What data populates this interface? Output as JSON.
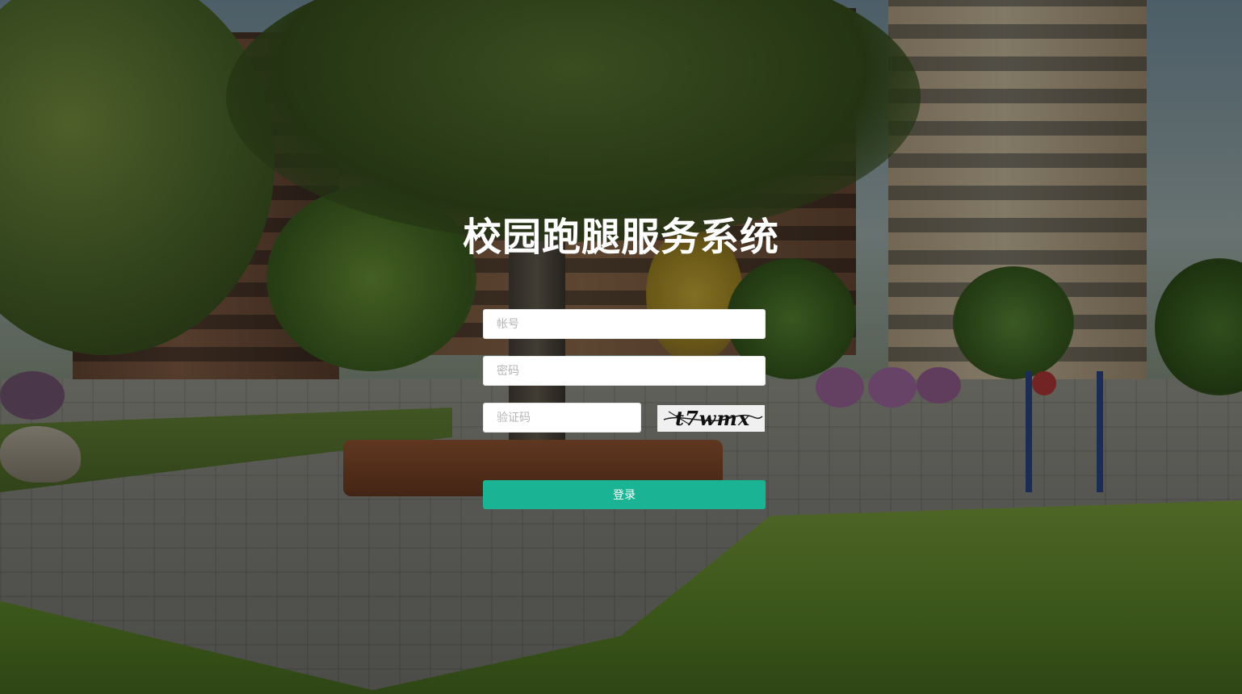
{
  "title": "校园跑腿服务系统",
  "form": {
    "account_placeholder": "帐号",
    "password_placeholder": "密码",
    "captcha_placeholder": "验证码",
    "captcha_image_text": "t7wmx",
    "login_label": "登录"
  },
  "colors": {
    "primary": "#1ab394",
    "title_text": "#ffffff",
    "overlay": "rgba(0,0,0,0.38)"
  },
  "background": {
    "description_icon": "campus-residential-garden-image"
  }
}
